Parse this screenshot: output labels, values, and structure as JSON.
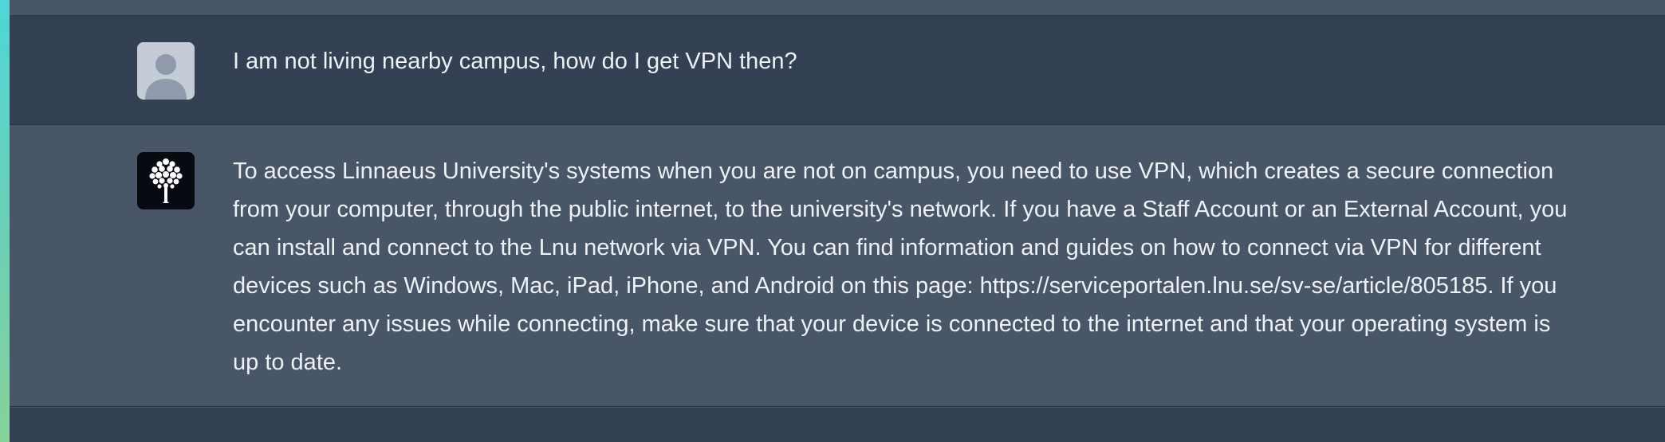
{
  "conversation": {
    "messages": [
      {
        "role": "user",
        "avatar_icon": "user-silhouette-icon",
        "text": "I am not living nearby campus, how do I get VPN then?"
      },
      {
        "role": "assistant",
        "avatar_icon": "tree-logo-icon",
        "text": "To access Linnaeus University's systems when you are not on campus, you need to use VPN, which creates a secure connection from your computer, through the public internet, to the university's network. If you have a Staff Account or an External Account, you can install and connect to the Lnu network via VPN. You can find information and guides on how to connect via VPN for different devices such as Windows, Mac, iPad, iPhone, and Android on this page: https://serviceportalen.lnu.se/sv-se/article/805185. If you encounter any issues while connecting, make sure that your device is connected to the internet and that your operating system is up to date."
      }
    ]
  },
  "colors": {
    "user_row_bg": "#344154",
    "assistant_row_bg": "#485668",
    "text": "#eef1f5",
    "edge_strip": "#4fd6d6"
  }
}
